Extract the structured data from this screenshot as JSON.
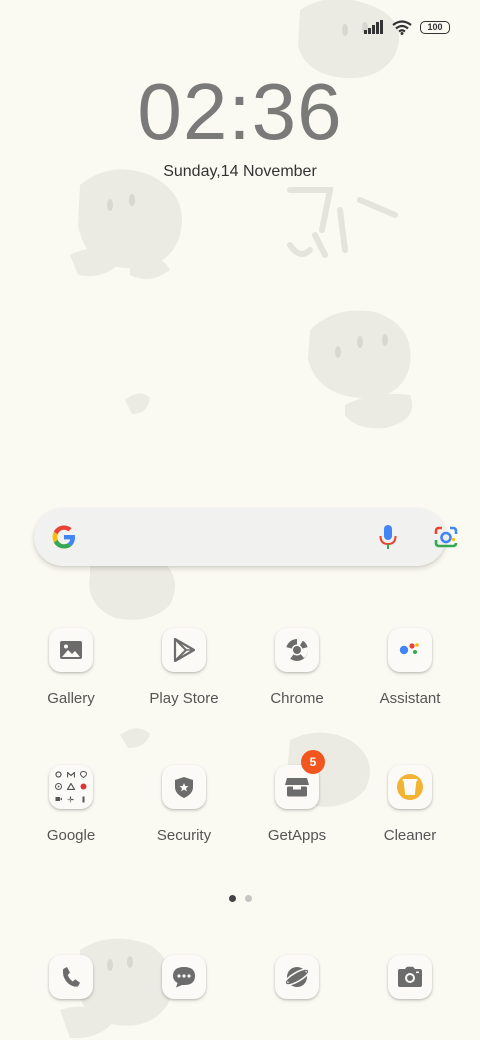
{
  "status_bar": {
    "battery": "100"
  },
  "clock": {
    "time": "02:36",
    "date": "Sunday,14 November"
  },
  "apps": [
    {
      "label": "Gallery",
      "icon": "gallery-icon"
    },
    {
      "label": "Play Store",
      "icon": "play-store-icon"
    },
    {
      "label": "Chrome",
      "icon": "chrome-icon"
    },
    {
      "label": "Assistant",
      "icon": "assistant-icon"
    },
    {
      "label": "Google",
      "icon": "google-folder-icon"
    },
    {
      "label": "Security",
      "icon": "security-icon"
    },
    {
      "label": "GetApps",
      "icon": "getapps-icon",
      "badge": "5"
    },
    {
      "label": "Cleaner",
      "icon": "cleaner-icon"
    }
  ],
  "dock": [
    "phone-icon",
    "messages-icon",
    "browser-icon",
    "camera-icon"
  ],
  "pages": {
    "count": 2,
    "active": 1
  },
  "colors": {
    "background": "#fbfaf2",
    "badge": "#f0561e",
    "icon_gray": "#6c6c6c",
    "cleaner": "#f2b233"
  }
}
